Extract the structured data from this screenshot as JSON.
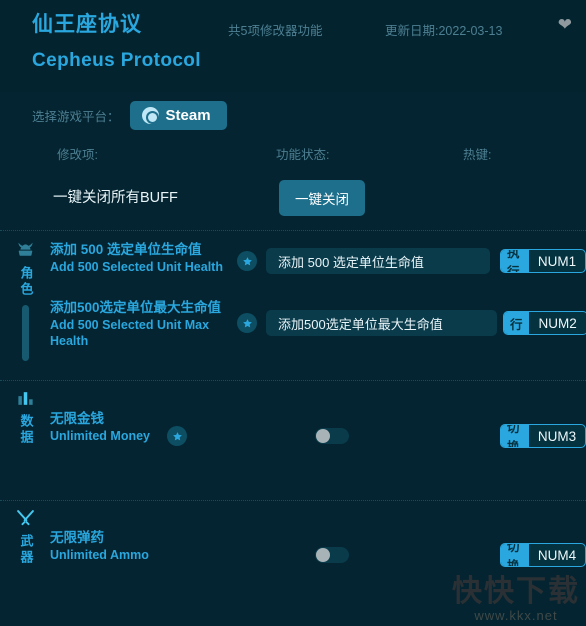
{
  "header": {
    "title_cn": "仙王座协议",
    "title_en": "Cepheus Protocol",
    "feature_count": "共5项修改器功能",
    "update_date": "更新日期:2022-03-13",
    "favorite_icon": "heart-icon"
  },
  "platform": {
    "label": "选择游戏平台：",
    "selected": "Steam",
    "icon": "steam-icon"
  },
  "columns": {
    "modifier": "修改项:",
    "state": "功能状态:",
    "hotkey": "热键:"
  },
  "all_off": {
    "label": "一键关闭所有BUFF",
    "button": "一键关闭"
  },
  "sections": [
    {
      "id": "character",
      "icon": "character-helmet-icon",
      "label": "角色",
      "rows": [
        {
          "name_cn": "添加 500 选定单位生命值",
          "name_en": "Add 500 Selected Unit Health",
          "control": "execute",
          "exec_label": "添加 500 选定单位生命值",
          "hotkey_action": "执行",
          "hotkey_key": "NUM1",
          "star": "star-icon"
        },
        {
          "name_cn": "添加500选定单位最大生命值",
          "name_en": "Add 500 Selected Unit Max Health",
          "control": "execute",
          "exec_label": "添加500选定单位最大生命值",
          "hotkey_action": "行",
          "hotkey_key": "NUM2",
          "star": "star-icon"
        }
      ]
    },
    {
      "id": "data",
      "icon": "bar-chart-icon",
      "label": "数据",
      "rows": [
        {
          "name_cn": "无限金钱",
          "name_en": "Unlimited Money",
          "control": "toggle",
          "toggle_state": "off",
          "hotkey_action": "切换",
          "hotkey_key": "NUM3",
          "star": "star-icon"
        }
      ]
    },
    {
      "id": "weapons",
      "icon": "crossed-swords-icon",
      "label": "武器",
      "rows": [
        {
          "name_cn": "无限弹药",
          "name_en": "Unlimited Ammo",
          "control": "toggle",
          "toggle_state": "off",
          "hotkey_action": "切换",
          "hotkey_key": "NUM4"
        }
      ]
    }
  ],
  "watermark": {
    "text_cn": "快快下载",
    "url": "www.kkx.net"
  },
  "colors": {
    "background": "#032430",
    "accent": "#2aa7de",
    "button": "#1d6f8b",
    "muted": "#4d7f92"
  }
}
